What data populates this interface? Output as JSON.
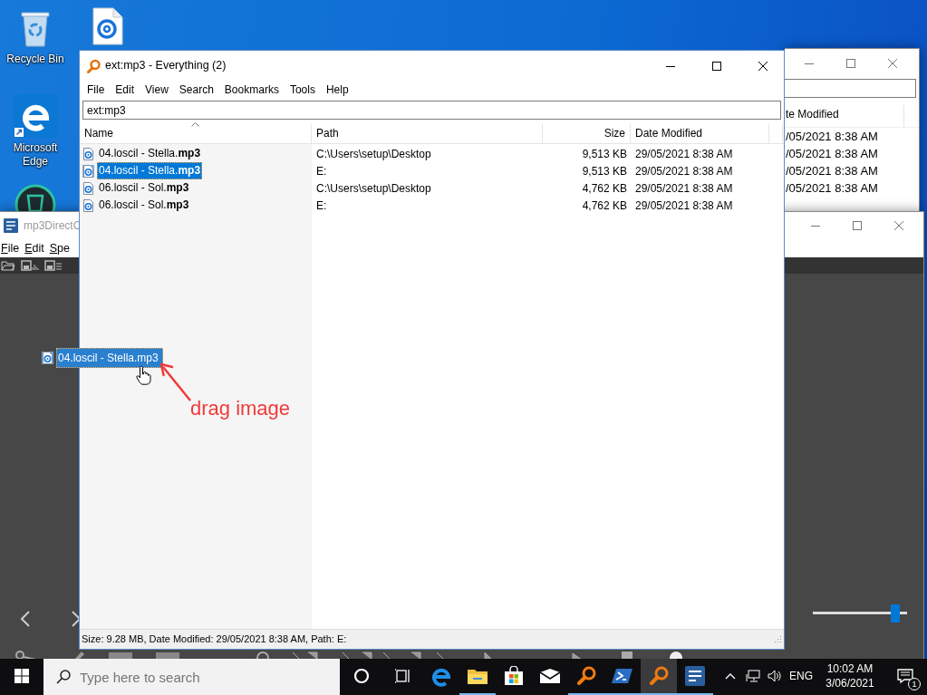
{
  "desktop_icons": [
    {
      "kind": "recycle",
      "label": "Recycle Bin"
    },
    {
      "kind": "audio"
    },
    {
      "kind": "edge",
      "label": "Microsoft Edge"
    },
    {
      "kind": "shield"
    }
  ],
  "back_window": {
    "column_header": "te Modified",
    "rows": [
      "/05/2021 8:38 AM",
      "/05/2021 8:38 AM",
      "/05/2021 8:38 AM",
      "/05/2021 8:38 AM"
    ]
  },
  "mp3directcut_window": {
    "title": "mp3DirectC",
    "menu": [
      "File",
      "Edit",
      "Spe"
    ],
    "volume": {
      "level": 0.92
    }
  },
  "everything_window": {
    "title": "ext:mp3 - Everything (2)",
    "menu": [
      "File",
      "Edit",
      "View",
      "Search",
      "Bookmarks",
      "Tools",
      "Help"
    ],
    "search": {
      "value": "ext:mp3"
    },
    "columns": [
      "Name",
      "Path",
      "Size",
      "Date Modified"
    ],
    "rows": [
      {
        "name": "04.loscil - Stella.**mp3**",
        "path": "C:\\Users\\setup\\Desktop",
        "size": "9,513 KB",
        "date": "29/05/2021 8:38 AM",
        "selected": false
      },
      {
        "name": "04.loscil - Stella.**mp3**",
        "path": "E:",
        "size": "9,513 KB",
        "date": "29/05/2021 8:38 AM",
        "selected": true
      },
      {
        "name": "06.loscil - Sol.**mp3**",
        "path": "C:\\Users\\setup\\Desktop",
        "size": "4,762 KB",
        "date": "29/05/2021 8:38 AM",
        "selected": false
      },
      {
        "name": "06.loscil - Sol.**mp3**",
        "path": "E:",
        "size": "4,762 KB",
        "date": "29/05/2021 8:38 AM",
        "selected": false
      }
    ],
    "status": "Size: 9.28 MB, Date Modified: 29/05/2021 8:38 AM, Path: E:"
  },
  "drag_image": {
    "label": "04.loscil - Stella.mp3"
  },
  "annotation": {
    "text": "drag image"
  },
  "taskbar": {
    "search": {
      "placeholder": "Type here to search"
    },
    "apps": [
      {
        "kind": "cortana",
        "running": false,
        "active": false
      },
      {
        "kind": "taskview",
        "running": false,
        "active": false
      },
      {
        "kind": "edge",
        "running": false,
        "active": false
      },
      {
        "kind": "explorer",
        "running": true,
        "active": false
      },
      {
        "kind": "store",
        "running": false,
        "active": false
      },
      {
        "kind": "mail",
        "running": false,
        "active": false
      },
      {
        "kind": "everything",
        "running": true,
        "active": false
      },
      {
        "kind": "powershell",
        "running": true,
        "active": false
      },
      {
        "kind": "everything",
        "running": true,
        "active": true
      },
      {
        "kind": "mp3",
        "running": true,
        "active": false
      }
    ],
    "language": "ENG",
    "time": "10:02 AM",
    "date": "3/06/2021",
    "notifications": "1"
  }
}
